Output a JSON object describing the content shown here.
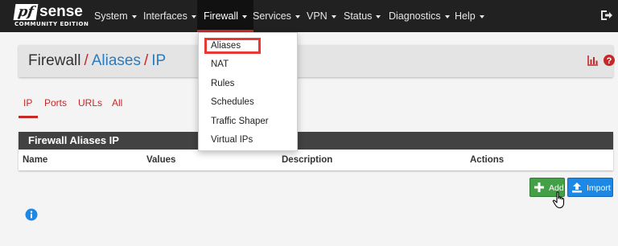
{
  "navbar": {
    "logo": {
      "main": "pf",
      "suffix": "sense",
      "edition": "COMMUNITY EDITION"
    },
    "menus": [
      {
        "label": "System"
      },
      {
        "label": "Interfaces"
      },
      {
        "label": "Firewall"
      },
      {
        "label": "Services"
      },
      {
        "label": "VPN"
      },
      {
        "label": "Status"
      },
      {
        "label": "Diagnostics"
      },
      {
        "label": "Help"
      }
    ],
    "active_menu": "Firewall",
    "logout_icon": "logout-icon"
  },
  "breadcrumb": {
    "root": "Firewall",
    "separator": "/",
    "level2": "Aliases",
    "level3": "IP"
  },
  "tabs": [
    {
      "label": "IP",
      "active": true
    },
    {
      "label": "Ports"
    },
    {
      "label": "URLs"
    },
    {
      "label": "All"
    }
  ],
  "table": {
    "title": "Firewall Aliases IP",
    "columns": [
      "Name",
      "Values",
      "Description",
      "Actions"
    ]
  },
  "buttons": {
    "add": "Add",
    "import": "Import"
  },
  "firewall_menu": {
    "items": [
      {
        "label": "Aliases",
        "highlighted": true
      },
      {
        "label": "NAT"
      },
      {
        "label": "Rules"
      },
      {
        "label": "Schedules"
      },
      {
        "label": "Traffic Shaper"
      },
      {
        "label": "Virtual IPs"
      }
    ]
  },
  "colors": {
    "navbar": "#212121",
    "accent_red": "#c62828",
    "link_blue": "#2c7bbf",
    "add_green": "#43a047",
    "import_blue": "#1e88e5"
  }
}
